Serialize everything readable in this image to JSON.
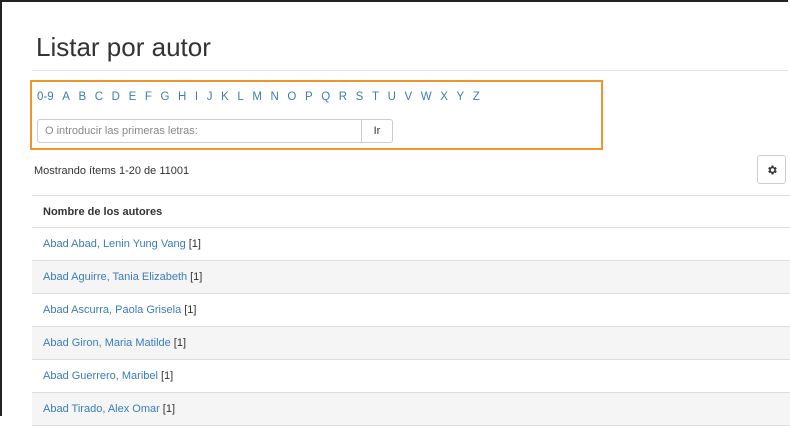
{
  "page": {
    "title": "Listar por autor"
  },
  "browse": {
    "letters": [
      "0-9",
      "A",
      "B",
      "C",
      "D",
      "E",
      "F",
      "G",
      "H",
      "I",
      "J",
      "K",
      "L",
      "M",
      "N",
      "O",
      "P",
      "Q",
      "R",
      "S",
      "T",
      "U",
      "V",
      "W",
      "X",
      "Y",
      "Z"
    ],
    "search_placeholder": "O introducir las primeras letras:",
    "go_label": "Ir"
  },
  "results": {
    "showing_text": "Mostrando ítems 1-20 de 11001",
    "settings_icon": "gear-icon"
  },
  "table": {
    "header": "Nombre de los autores",
    "rows": [
      {
        "name": "Abad Abad, Lenin Yung Vang",
        "count": "[1]"
      },
      {
        "name": "Abad Aguirre, Tania Elizabeth",
        "count": "[1]"
      },
      {
        "name": "Abad Ascurra, Paola Grisela",
        "count": "[1]"
      },
      {
        "name": "Abad Giron, Maria Matilde",
        "count": "[1]"
      },
      {
        "name": "Abad Guerrero, Maribel",
        "count": "[1]"
      },
      {
        "name": "Abad Tirado, Alex Omar",
        "count": "[1]"
      }
    ]
  },
  "colors": {
    "link": "#3a7cb8",
    "highlight_border": "#f0952b",
    "row_stripe": "#f5f5f5"
  }
}
